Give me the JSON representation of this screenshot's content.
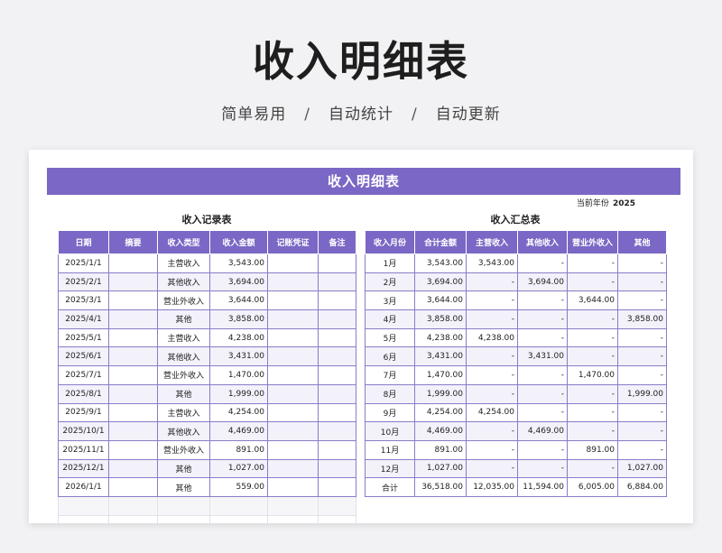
{
  "hero": {
    "title": "收入明细表",
    "subtitle_items": [
      "简单易用",
      "自动统计",
      "自动更新"
    ],
    "separator": "/"
  },
  "sheet": {
    "banner": "收入明细表",
    "year_label": "当前年份",
    "year_value": "2025",
    "accent_color": "#7b67c5"
  },
  "record_table": {
    "title": "收入记录表",
    "headers": [
      "日期",
      "摘要",
      "收入类型",
      "收入金额",
      "记账凭证",
      "备注"
    ],
    "rows": [
      [
        "2025/1/1",
        "",
        "主营收入",
        "3,543.00",
        "",
        ""
      ],
      [
        "2025/2/1",
        "",
        "其他收入",
        "3,694.00",
        "",
        ""
      ],
      [
        "2025/3/1",
        "",
        "营业外收入",
        "3,644.00",
        "",
        ""
      ],
      [
        "2025/4/1",
        "",
        "其他",
        "3,858.00",
        "",
        ""
      ],
      [
        "2025/5/1",
        "",
        "主营收入",
        "4,238.00",
        "",
        ""
      ],
      [
        "2025/6/1",
        "",
        "其他收入",
        "3,431.00",
        "",
        ""
      ],
      [
        "2025/7/1",
        "",
        "营业外收入",
        "1,470.00",
        "",
        ""
      ],
      [
        "2025/8/1",
        "",
        "其他",
        "1,999.00",
        "",
        ""
      ],
      [
        "2025/9/1",
        "",
        "主营收入",
        "4,254.00",
        "",
        ""
      ],
      [
        "2025/10/1",
        "",
        "其他收入",
        "4,469.00",
        "",
        ""
      ],
      [
        "2025/11/1",
        "",
        "营业外收入",
        "891.00",
        "",
        ""
      ],
      [
        "2025/12/1",
        "",
        "其他",
        "1,027.00",
        "",
        ""
      ],
      [
        "2026/1/1",
        "",
        "其他",
        "559.00",
        "",
        ""
      ]
    ]
  },
  "summary_table": {
    "title": "收入汇总表",
    "headers": [
      "收入月份",
      "合计金额",
      "主营收入",
      "其他收入",
      "营业外收入",
      "其他"
    ],
    "rows": [
      [
        "1月",
        "3,543.00",
        "3,543.00",
        "-",
        "-",
        "-"
      ],
      [
        "2月",
        "3,694.00",
        "-",
        "3,694.00",
        "-",
        "-"
      ],
      [
        "3月",
        "3,644.00",
        "-",
        "-",
        "3,644.00",
        "-"
      ],
      [
        "4月",
        "3,858.00",
        "-",
        "-",
        "-",
        "3,858.00"
      ],
      [
        "5月",
        "4,238.00",
        "4,238.00",
        "-",
        "-",
        "-"
      ],
      [
        "6月",
        "3,431.00",
        "-",
        "3,431.00",
        "-",
        "-"
      ],
      [
        "7月",
        "1,470.00",
        "-",
        "-",
        "1,470.00",
        "-"
      ],
      [
        "8月",
        "1,999.00",
        "-",
        "-",
        "-",
        "1,999.00"
      ],
      [
        "9月",
        "4,254.00",
        "4,254.00",
        "-",
        "-",
        "-"
      ],
      [
        "10月",
        "4,469.00",
        "-",
        "4,469.00",
        "-",
        "-"
      ],
      [
        "11月",
        "891.00",
        "-",
        "-",
        "891.00",
        "-"
      ],
      [
        "12月",
        "1,027.00",
        "-",
        "-",
        "-",
        "1,027.00"
      ],
      [
        "合计",
        "36,518.00",
        "12,035.00",
        "11,594.00",
        "6,005.00",
        "6,884.00"
      ]
    ]
  }
}
